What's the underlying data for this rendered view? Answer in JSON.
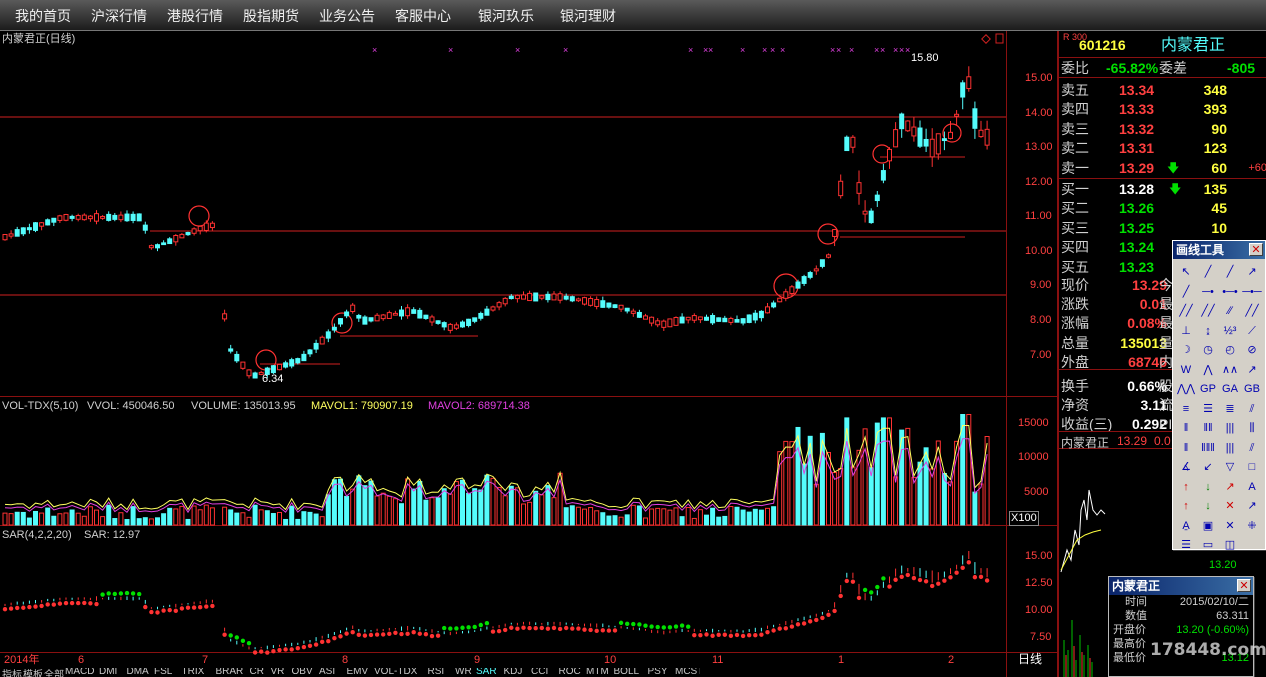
{
  "menu": [
    "我的首页",
    "沪深行情",
    "港股行情",
    "股指期货",
    "业务公告",
    "客服中心",
    "银河玖乐",
    "银河理财"
  ],
  "chart_title": "内蒙君正(日线)",
  "price_axis": [
    "15.00",
    "14.00",
    "13.00",
    "12.00",
    "11.00",
    "10.00",
    "9.00",
    "8.00",
    "7.00"
  ],
  "annotations": {
    "high": "15.80",
    "low": "6.34"
  },
  "volume_header": {
    "name": "VOL-TDX(5,10)",
    "vvol": "VVOL: 450046.50",
    "volume": "VOLUME: 135013.95",
    "mavol1": "MAVOL1: 790907.19",
    "mavol2": "MAVOL2: 689714.38"
  },
  "volume_axis": [
    "15000",
    "10000",
    "5000"
  ],
  "volume_unit": "X100",
  "sar_header": {
    "name": "SAR(4,2,2,20)",
    "value": "SAR: 12.97"
  },
  "sar_axis": [
    "15.00",
    "12.50",
    "10.00",
    "7.50"
  ],
  "time_axis": [
    "2014年",
    "6",
    "7",
    "8",
    "9",
    "10",
    "11",
    "1",
    "2"
  ],
  "period_label": "日线",
  "bottom_tabs": [
    "指标",
    "模板",
    "全部",
    "MACD",
    "DMI",
    "DMA",
    "FSL",
    "TRIX",
    "BRAR",
    "CR",
    "VR",
    "OBV",
    "ASI",
    "EMV",
    "VOL-TDX",
    "RSI",
    "WR",
    "SAR",
    "KDJ",
    "CCI",
    "ROC",
    "MTM",
    "BOLL",
    "PSY",
    "MCST"
  ],
  "colors": {
    "up": "#ff3232",
    "down": "#54fcfc",
    "border": "#8a1010",
    "sar_up": "#00e000",
    "magenta": "#e040e0"
  },
  "quote": {
    "badge": "R 300",
    "code": "601216",
    "name": "内蒙君正",
    "wb_label": "委比",
    "wb_value": "-65.82%",
    "wc_label": "委差",
    "wc_value": "-805",
    "sells": [
      {
        "label": "卖五",
        "price": "13.34",
        "vol": "348"
      },
      {
        "label": "卖四",
        "price": "13.33",
        "vol": "393"
      },
      {
        "label": "卖三",
        "price": "13.32",
        "vol": "90"
      },
      {
        "label": "卖二",
        "price": "13.31",
        "vol": "123"
      },
      {
        "label": "卖一",
        "price": "13.29",
        "vol": "60",
        "extra": "+60"
      }
    ],
    "buys": [
      {
        "label": "买一",
        "price": "13.28",
        "vol": "135"
      },
      {
        "label": "买二",
        "price": "13.26",
        "vol": "45"
      },
      {
        "label": "买三",
        "price": "13.25",
        "vol": "10"
      },
      {
        "label": "买四",
        "price": "13.24",
        "vol": ""
      },
      {
        "label": "买五",
        "price": "13.23",
        "vol": ""
      }
    ],
    "stats": [
      {
        "label": "现价",
        "value": "13.29",
        "tail": "今"
      },
      {
        "label": "涨跌",
        "value": "0.01",
        "tail": "最"
      },
      {
        "label": "涨幅",
        "value": "0.08%",
        "tail": "最"
      },
      {
        "label": "总量",
        "value": "135013",
        "tail": "量"
      },
      {
        "label": "外盘",
        "value": "68746",
        "tail": "内"
      },
      {
        "label": "换手",
        "value": "0.66%",
        "tail": "股"
      },
      {
        "label": "净资",
        "value": "3.11",
        "tail": "流"
      },
      {
        "label": "收益(三)",
        "value": "0.292",
        "tail": "PI"
      }
    ],
    "mini_title": "内蒙君正",
    "mini_price": "13.29",
    "mini_change": "0.0",
    "mini_axis": "13.20"
  },
  "drawing_tools": {
    "title": "画线工具"
  },
  "info_window": {
    "title": "内蒙君正",
    "rows": [
      {
        "label": "时间",
        "value": "2015/02/10/二"
      },
      {
        "label": "数值",
        "value": "63.311"
      },
      {
        "label": "开盘价",
        "value": "13.20 (-0.60%)"
      },
      {
        "label": "最高价",
        "value": ""
      },
      {
        "label": "最低价",
        "value": "13.12"
      }
    ]
  },
  "watermark": "178448.com"
}
